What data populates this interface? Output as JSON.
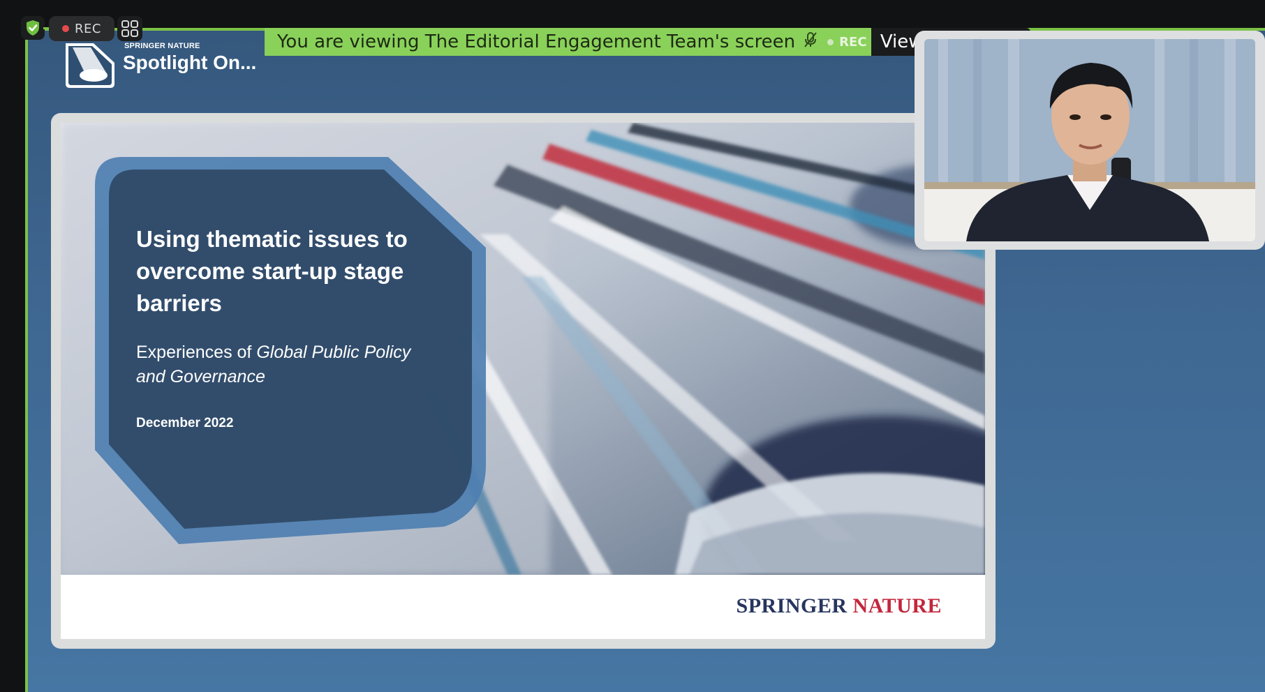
{
  "controls": {
    "rec_label": "REC"
  },
  "banner": {
    "viewing_text": "You are viewing The Editorial Engagement Team's screen",
    "rec_label": "REC",
    "view_options_label": "View Options"
  },
  "header": {
    "brand_small": "SPRINGER NATURE",
    "series_title": "Spotlight On..."
  },
  "slide": {
    "title": "Using thematic issues to overcome start-up stage barriers",
    "subtitle_prefix": "Experiences of ",
    "subtitle_italic": "Global Public Policy and Governance",
    "date": "December 2022",
    "brand_part1": "SPRINGER",
    "brand_part2": "NATURE"
  },
  "colors": {
    "accent_green": "#8ad15a",
    "border_green": "#7cc247",
    "share_bg": "#3e6690",
    "brand_blue": "#26355e",
    "brand_red": "#c4263c"
  }
}
